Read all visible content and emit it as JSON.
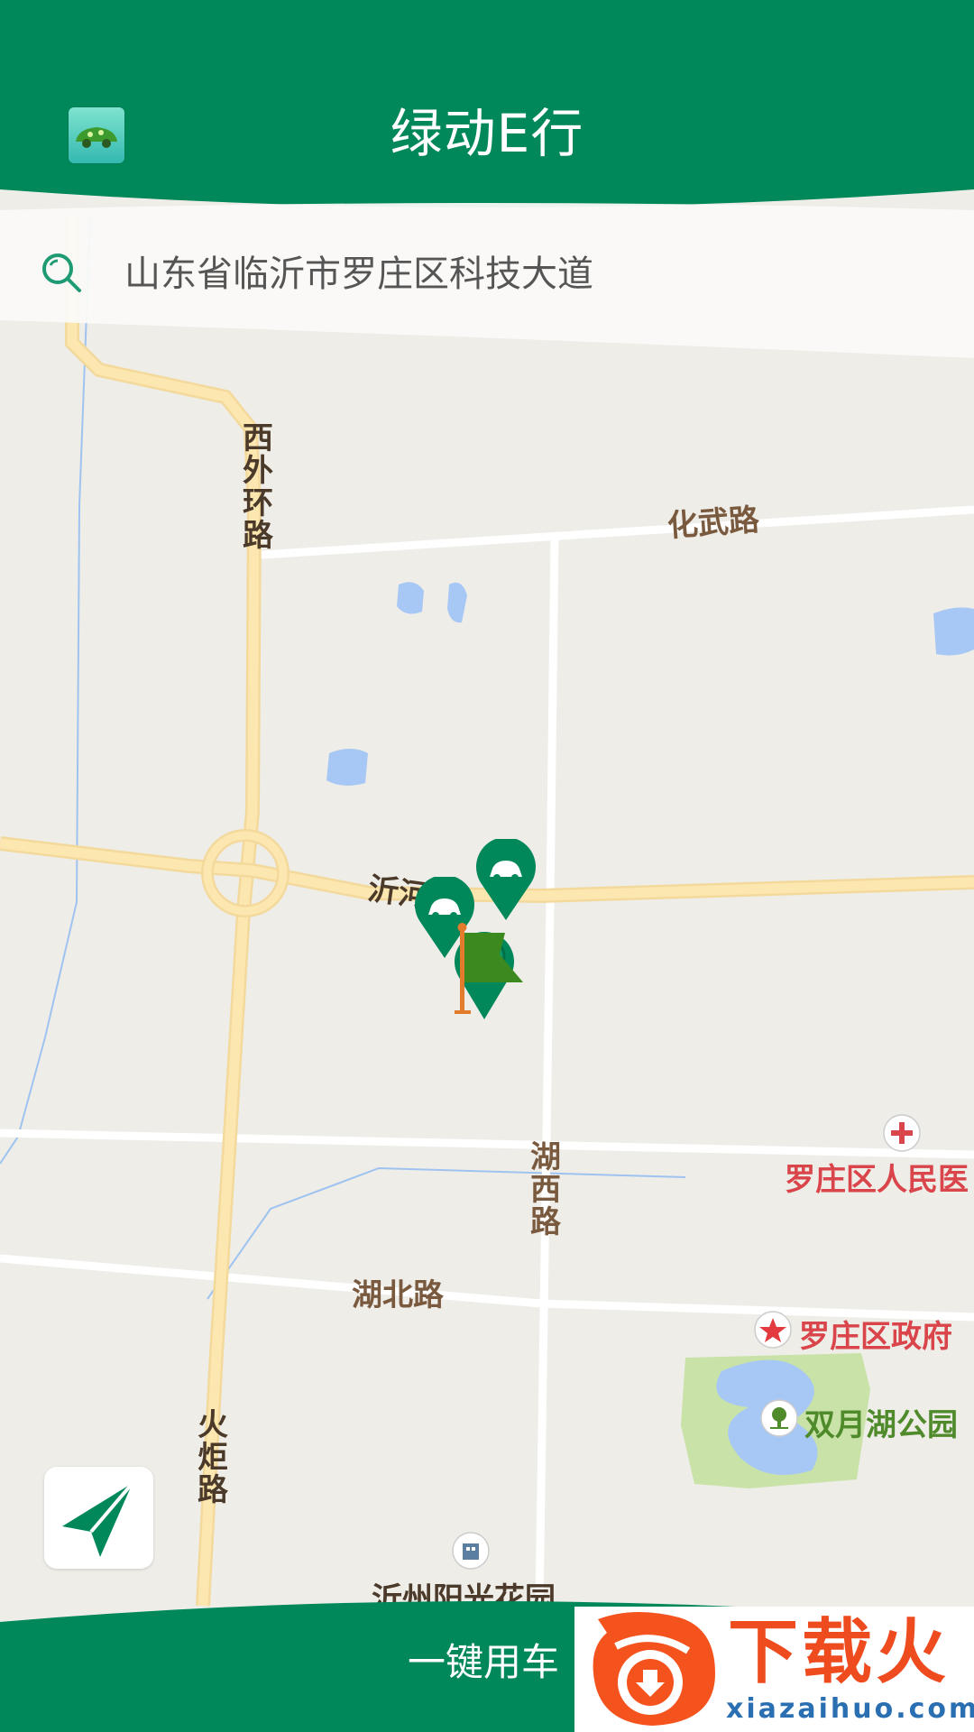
{
  "header": {
    "title": "绿动E行",
    "app_icon": "car-app-icon"
  },
  "search": {
    "address": "山东省临沂市罗庄区科技大道",
    "icon": "search-icon"
  },
  "map": {
    "roads": {
      "xiwaihuan": "西外环路",
      "huawu": "化武路",
      "yihe": "沂河",
      "huxi": "湖西路",
      "hubei": "湖北路",
      "huoju": "火炬路"
    },
    "pois": {
      "hospital": "罗庄区人民医",
      "government": "罗庄区政府",
      "park": "双月湖公园",
      "residential": "沂州阳光花园"
    },
    "markers": [
      "car-marker",
      "car-marker",
      "destination-flag"
    ]
  },
  "bottom": {
    "use_car_label": "一键用车"
  },
  "watermark": {
    "brand": "下载火",
    "url": "xiazaihuo.com"
  },
  "colors": {
    "primary": "#00875a",
    "water": "#a7c8f5",
    "road": "#fde7b0",
    "park": "#c9e2a8",
    "poi_red": "#d9454a",
    "poi_green": "#4f8a2b"
  }
}
